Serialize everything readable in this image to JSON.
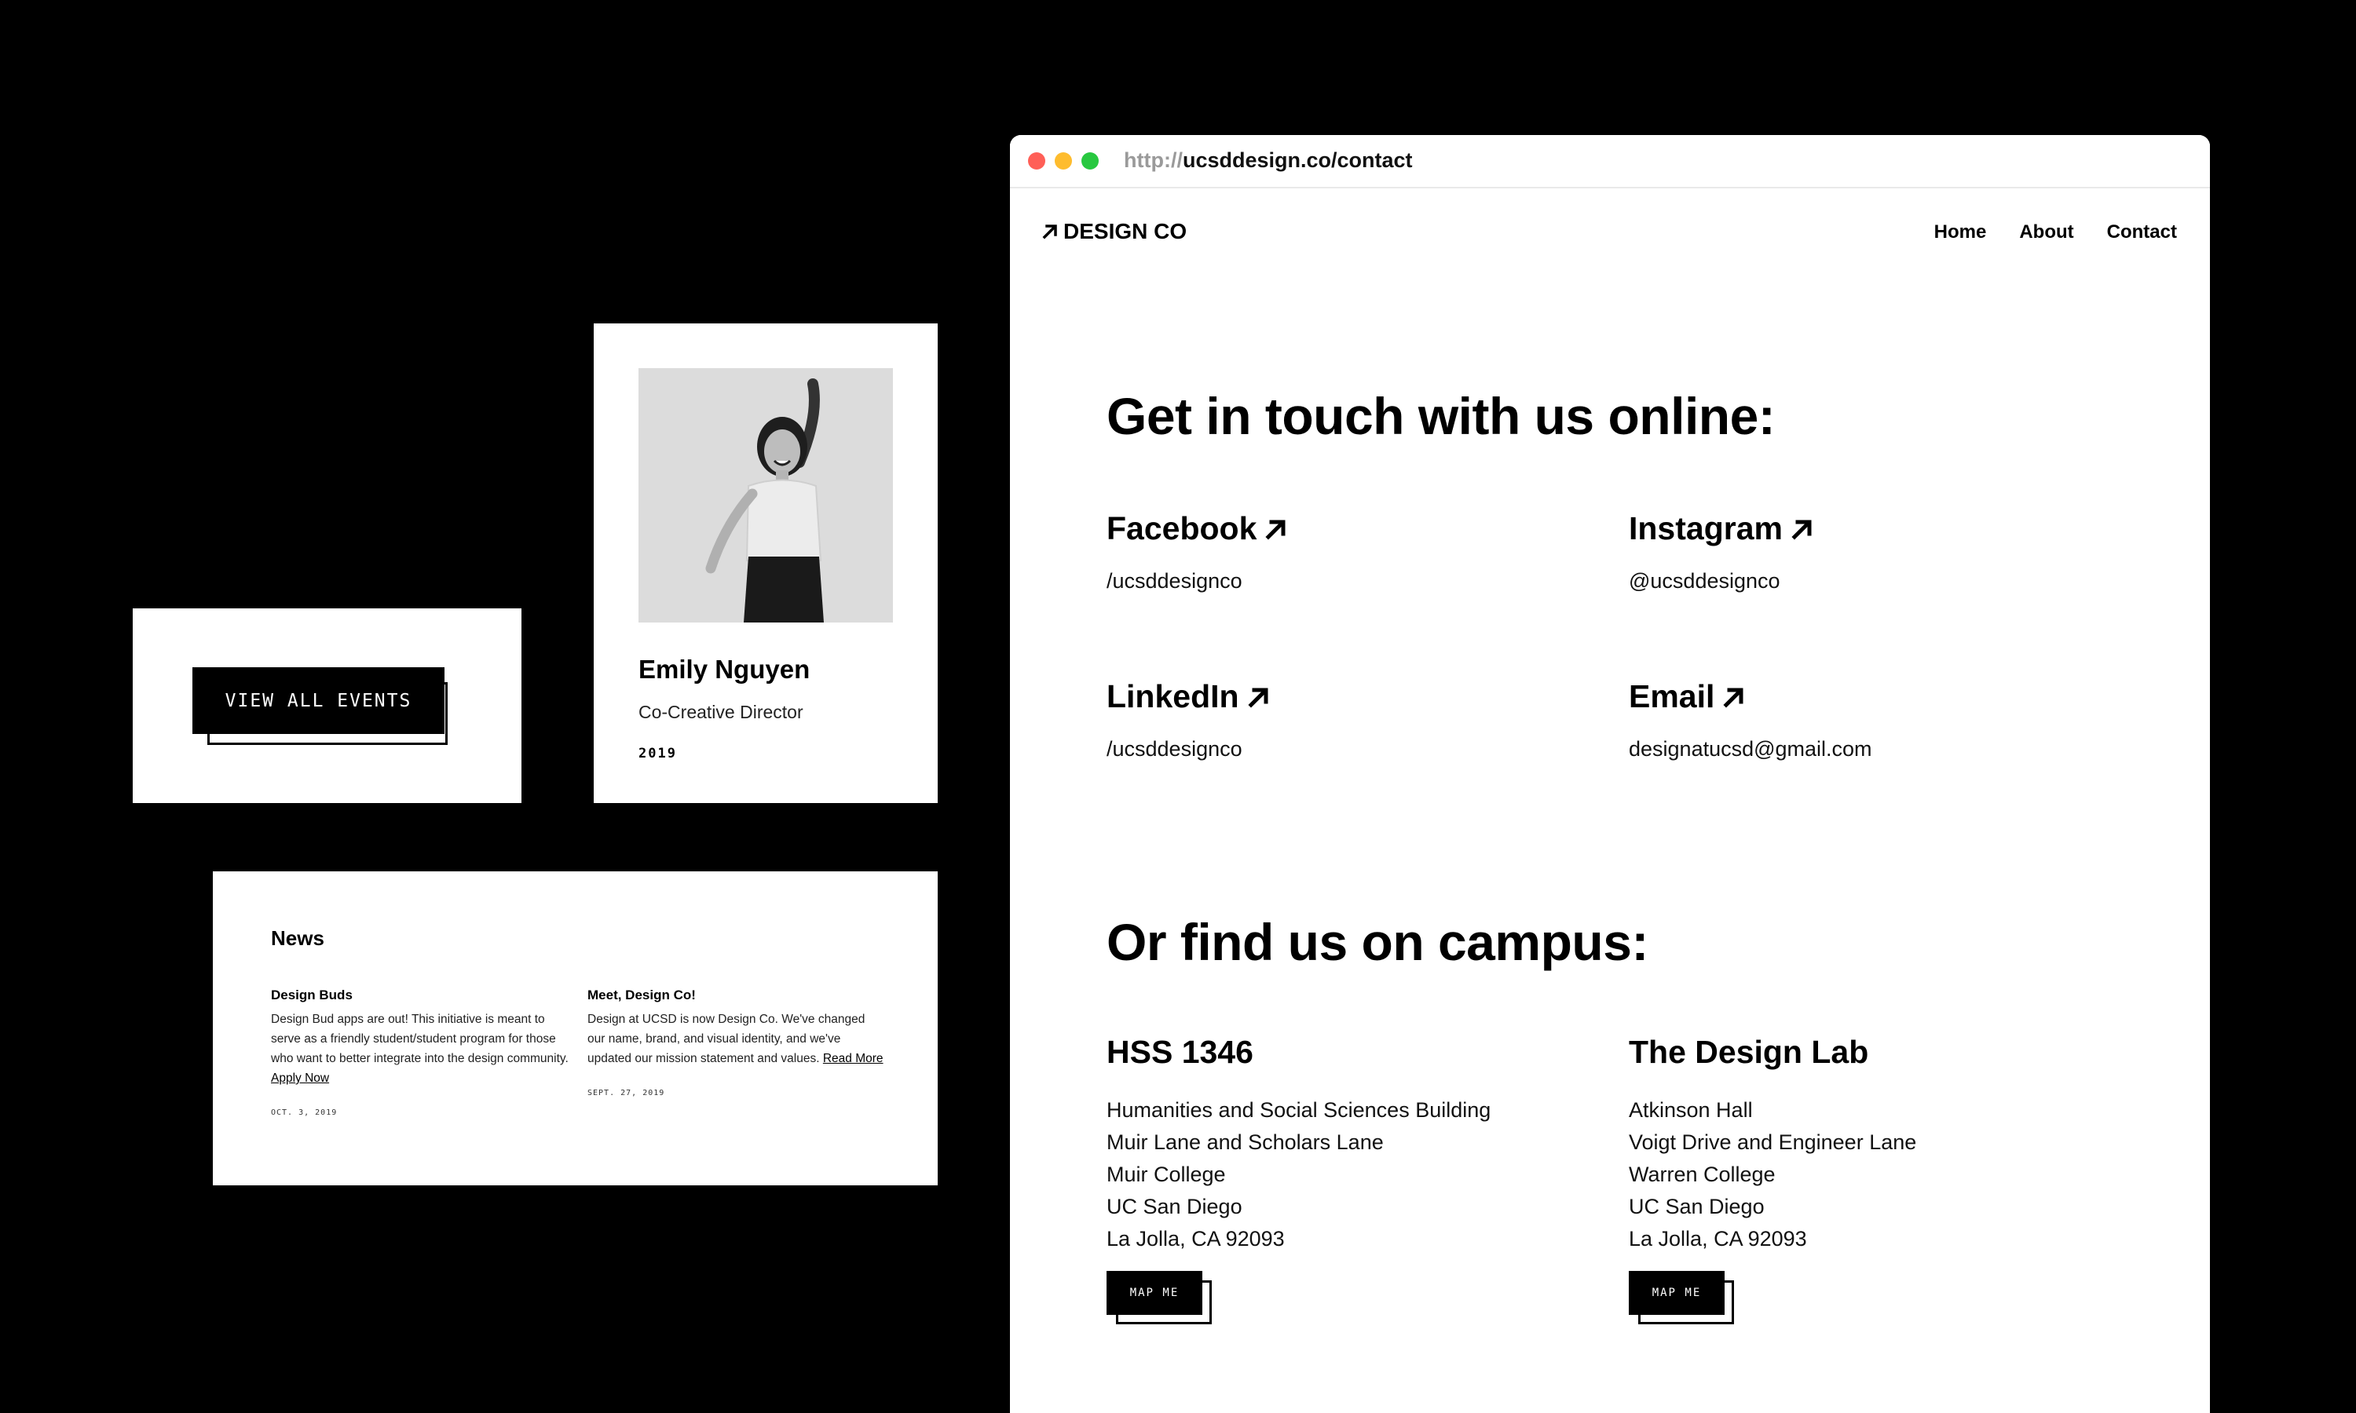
{
  "events_card": {
    "button_label": "VIEW ALL EVENTS"
  },
  "profile_card": {
    "name": "Emily Nguyen",
    "role": "Co-Creative Director",
    "year": "2019"
  },
  "news_card": {
    "title": "News",
    "items": [
      {
        "title": "Design Buds",
        "body": "Design Bud apps are out! This initiative is meant to serve as a friendly student/student program for those who want to better integrate into the design community.",
        "link_label": "Apply Now",
        "date": "OCT. 3, 2019"
      },
      {
        "title": "Meet, Design Co!",
        "body": "Design at UCSD is now Design Co. We've changed our name, brand, and visual identity, and we've updated our mission statement and values.",
        "link_label": "Read More",
        "date": "SEPT. 27, 2019"
      }
    ]
  },
  "browser": {
    "url_protocol": "http://",
    "url_path": "ucsddesign.co/contact",
    "logo": "DESIGN CO",
    "nav": [
      "Home",
      "About",
      "Contact"
    ],
    "online_heading": "Get in touch with us online:",
    "socials": [
      {
        "name": "Facebook",
        "handle": "/ucsddesignco"
      },
      {
        "name": "Instagram",
        "handle": "@ucsddesignco"
      },
      {
        "name": "LinkedIn",
        "handle": "/ucsddesignco"
      },
      {
        "name": "Email",
        "handle": "designatucsd@gmail.com"
      }
    ],
    "campus_heading": "Or find us on campus:",
    "locations": [
      {
        "name": "HSS 1346",
        "lines": [
          "Humanities and Social Sciences Building",
          "Muir Lane and Scholars Lane",
          "Muir College",
          "UC San Diego",
          "La Jolla, CA 92093"
        ],
        "button_label": "MAP ME"
      },
      {
        "name": "The Design Lab",
        "lines": [
          "Atkinson Hall",
          "Voigt Drive and Engineer Lane",
          "Warren College",
          "UC San Diego",
          "La Jolla, CA 92093"
        ],
        "button_label": "MAP ME"
      }
    ]
  },
  "colors": {
    "background": "#000000",
    "card": "#ffffff",
    "dot_red": "#ff5f57",
    "dot_yellow": "#febc2e",
    "dot_green": "#28c840",
    "url_protocol": "#9a9a9a"
  },
  "icons": [
    "arrow-up-right-icon",
    "profile-photo"
  ]
}
